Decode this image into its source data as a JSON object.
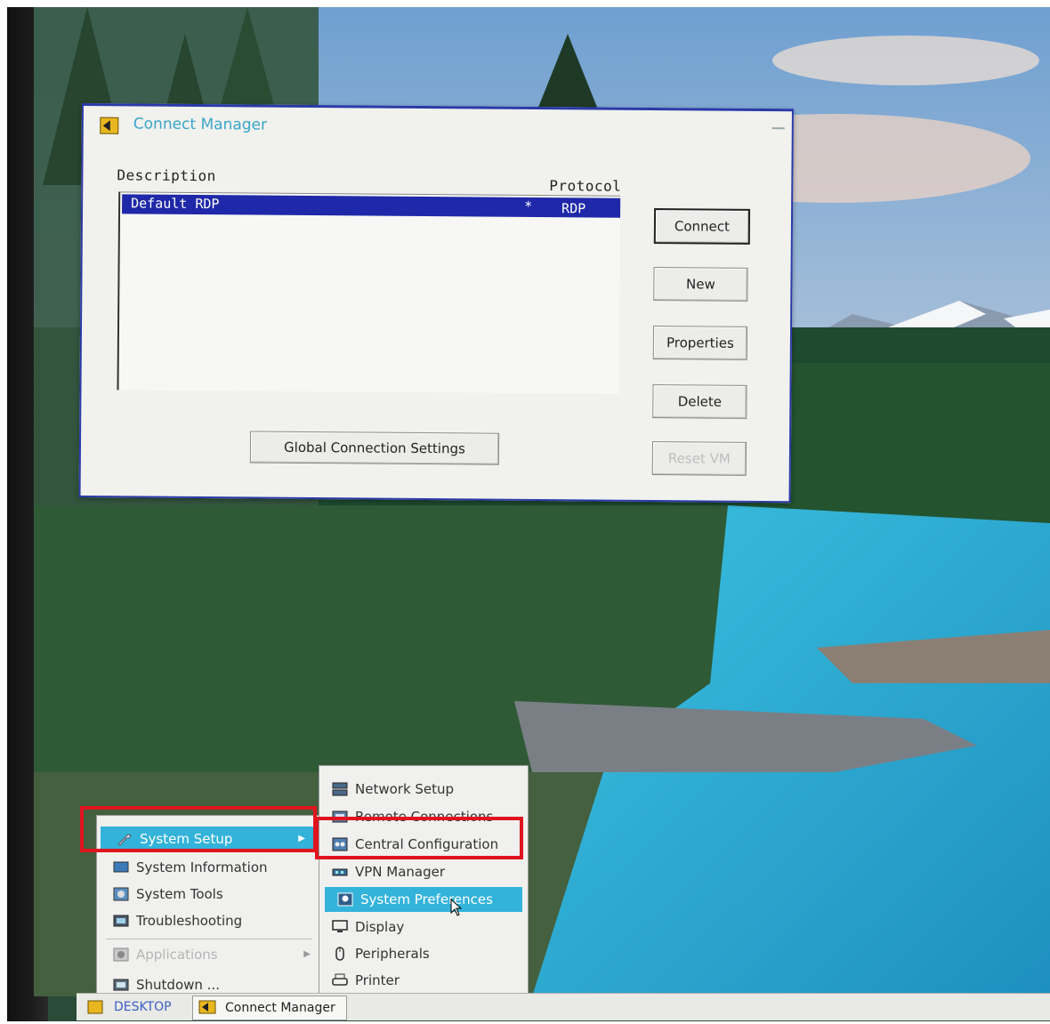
{
  "window": {
    "title": "Connect Manager",
    "columns": {
      "description": "Description",
      "protocol": "Protocol"
    },
    "connections": [
      {
        "description": "Default RDP",
        "marker": "*",
        "protocol": "RDP",
        "selected": true
      }
    ],
    "buttons": {
      "connect": "Connect",
      "new": "New",
      "properties": "Properties",
      "delete": "Delete",
      "reset": "Reset VM",
      "global_settings": "Global Connection Settings"
    }
  },
  "start_menu": {
    "items": [
      {
        "label": "System Setup",
        "icon": "wrench-icon",
        "highlighted": true,
        "has_submenu": true
      },
      {
        "label": "System Information",
        "icon": "monitor-info-icon"
      },
      {
        "label": "System Tools",
        "icon": "tools-icon"
      },
      {
        "label": "Troubleshooting",
        "icon": "troubleshooting-icon"
      },
      {
        "label": "Applications",
        "icon": "applications-icon",
        "disabled": true,
        "has_submenu": true
      },
      {
        "label": "Shutdown ...",
        "icon": "shutdown-icon"
      }
    ]
  },
  "system_setup_submenu": {
    "items": [
      {
        "label": "Network Setup",
        "icon": "network-icon"
      },
      {
        "label": "Remote Connections",
        "icon": "remote-connections-icon"
      },
      {
        "label": "Central Configuration",
        "icon": "central-config-icon"
      },
      {
        "label": "VPN Manager",
        "icon": "vpn-icon"
      },
      {
        "label": "System Preferences",
        "icon": "preferences-icon",
        "highlighted": true
      },
      {
        "label": "Display",
        "icon": "display-icon"
      },
      {
        "label": "Peripherals",
        "icon": "mouse-icon"
      },
      {
        "label": "Printer",
        "icon": "printer-icon"
      }
    ]
  },
  "taskbar": {
    "start_label": "DESKTOP",
    "task_label": "Connect Manager"
  },
  "colors": {
    "menu_highlight": "#33b3da",
    "selection": "#1e28a8",
    "annotation_box": "#e0141e",
    "title_text": "#3aa6c8"
  }
}
